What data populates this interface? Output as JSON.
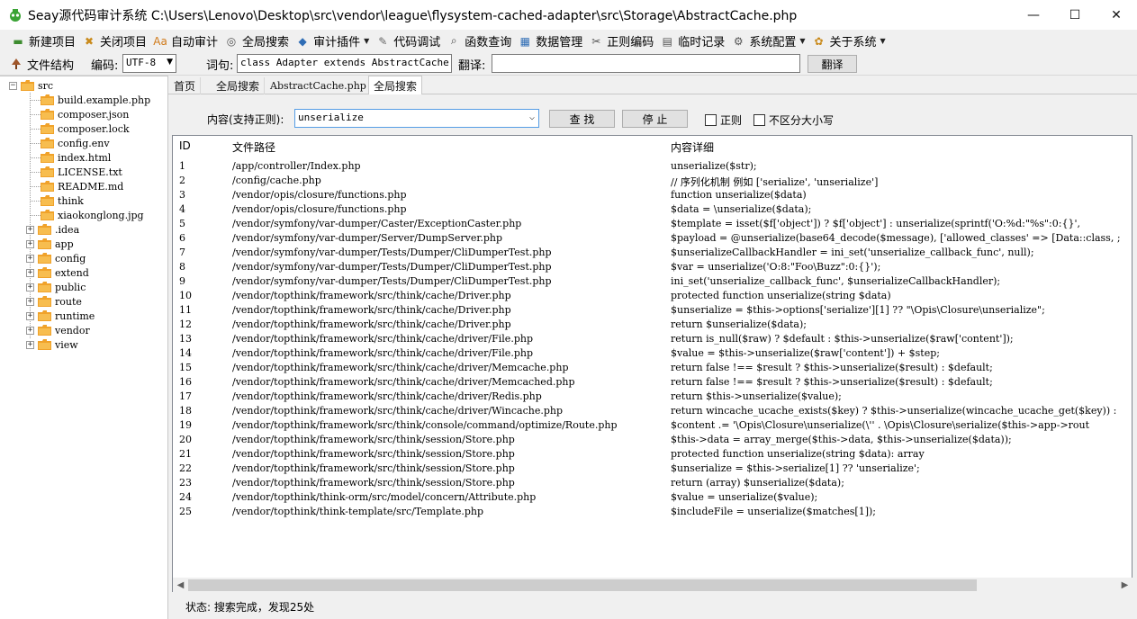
{
  "window": {
    "title": "Seay源代码审计系统  C:\\Users\\Lenovo\\Desktop\\src\\vendor\\league\\flysystem-cached-adapter\\src\\Storage\\AbstractCache.php",
    "minimize": "—",
    "maximize": "☐",
    "close": "✕"
  },
  "menu": [
    {
      "label": "新建项目",
      "icon": "new-project-icon",
      "glyph": "▬",
      "color": "#3d8c2f",
      "dropdown": false
    },
    {
      "label": "关闭项目",
      "icon": "close-project-icon",
      "glyph": "✖",
      "color": "#c98a1b",
      "dropdown": false
    },
    {
      "label": "自动审计",
      "icon": "auto-audit-icon",
      "glyph": "Aa",
      "color": "#d07a1a",
      "dropdown": false
    },
    {
      "label": "全局搜索",
      "icon": "global-search-icon",
      "glyph": "◎",
      "color": "#555555",
      "dropdown": false
    },
    {
      "label": "审计插件",
      "icon": "plugin-icon",
      "glyph": "◆",
      "color": "#2f6db5",
      "dropdown": true
    },
    {
      "label": "代码调试",
      "icon": "debug-icon",
      "glyph": "✎",
      "color": "#666666",
      "dropdown": false
    },
    {
      "label": "函数查询",
      "icon": "function-search-icon",
      "glyph": "⌕",
      "color": "#444444",
      "dropdown": false
    },
    {
      "label": "数据管理",
      "icon": "database-icon",
      "glyph": "▦",
      "color": "#2f6db5",
      "dropdown": false
    },
    {
      "label": "正则编码",
      "icon": "regex-icon",
      "glyph": "✂",
      "color": "#555555",
      "dropdown": false
    },
    {
      "label": "临时记录",
      "icon": "notes-icon",
      "glyph": "▤",
      "color": "#555555",
      "dropdown": false
    },
    {
      "label": "系统配置",
      "icon": "gear-icon",
      "glyph": "⚙",
      "color": "#555555",
      "dropdown": true
    },
    {
      "label": "关于系统",
      "icon": "about-icon",
      "glyph": "✿",
      "color": "#c98a1b",
      "dropdown": true
    }
  ],
  "toolbar": {
    "file_structure": "文件结构",
    "encoding_label": "编码:",
    "encoding_value": "UTF-8",
    "lexicon_label": "词句:",
    "lexicon_value": "class Adapter extends AbstractCache",
    "translate_label": "翻译:",
    "translate_value": "",
    "translate_button": "翻译"
  },
  "tree": {
    "root": "src",
    "files": [
      "build.example.php",
      "composer.json",
      "composer.lock",
      "config.env",
      "index.html",
      "LICENSE.txt",
      "README.md",
      "think",
      "xiaokonglong.jpg"
    ],
    "folders": [
      ".idea",
      "app",
      "config",
      "extend",
      "public",
      "route",
      "runtime",
      "vendor",
      "view"
    ]
  },
  "tabs": [
    "首页",
    "全局搜索",
    "AbstractCache.php",
    "全局搜索"
  ],
  "search": {
    "content_label": "内容(支持正则):",
    "query": "unserialize",
    "find_button": "查 找",
    "stop_button": "停 止",
    "regex_label": "正则",
    "ignore_case_label": "不区分大小写"
  },
  "columns": [
    "ID",
    "文件路径",
    "内容详细"
  ],
  "rows": [
    [
      "1",
      "/app/controller/Index.php",
      "unserialize($str);"
    ],
    [
      "2",
      "/config/cache.php",
      "// 序列化机制 例如 ['serialize', 'unserialize']"
    ],
    [
      "3",
      "/vendor/opis/closure/functions.php",
      "function unserialize($data)"
    ],
    [
      "4",
      "/vendor/opis/closure/functions.php",
      "$data = \\unserialize($data);"
    ],
    [
      "5",
      "/vendor/symfony/var-dumper/Caster/ExceptionCaster.php",
      "$template = isset($f['object']) ? $f['object'] : unserialize(sprintf('O:%d:\"%s\":0:{}',"
    ],
    [
      "6",
      "/vendor/symfony/var-dumper/Server/DumpServer.php",
      "$payload = @unserialize(base64_decode($message), ['allowed_classes' => [Data::class, ;"
    ],
    [
      "7",
      "/vendor/symfony/var-dumper/Tests/Dumper/CliDumperTest.php",
      "$unserializeCallbackHandler = ini_set('unserialize_callback_func', null);"
    ],
    [
      "8",
      "/vendor/symfony/var-dumper/Tests/Dumper/CliDumperTest.php",
      "$var = unserialize('O:8:\"Foo\\Buzz\":0:{}');"
    ],
    [
      "9",
      "/vendor/symfony/var-dumper/Tests/Dumper/CliDumperTest.php",
      "ini_set('unserialize_callback_func', $unserializeCallbackHandler);"
    ],
    [
      "10",
      "/vendor/topthink/framework/src/think/cache/Driver.php",
      "protected function unserialize(string $data)"
    ],
    [
      "11",
      "/vendor/topthink/framework/src/think/cache/Driver.php",
      "$unserialize = $this->options['serialize'][1] ?? \"\\Opis\\Closure\\unserialize\";"
    ],
    [
      "12",
      "/vendor/topthink/framework/src/think/cache/Driver.php",
      "return $unserialize($data);"
    ],
    [
      "13",
      "/vendor/topthink/framework/src/think/cache/driver/File.php",
      "return is_null($raw) ? $default : $this->unserialize($raw['content']);"
    ],
    [
      "14",
      "/vendor/topthink/framework/src/think/cache/driver/File.php",
      "$value  = $this->unserialize($raw['content']) + $step;"
    ],
    [
      "15",
      "/vendor/topthink/framework/src/think/cache/driver/Memcache.php",
      "return false !== $result ? $this->unserialize($result) : $default;"
    ],
    [
      "16",
      "/vendor/topthink/framework/src/think/cache/driver/Memcached.php",
      "return false !== $result ? $this->unserialize($result) : $default;"
    ],
    [
      "17",
      "/vendor/topthink/framework/src/think/cache/driver/Redis.php",
      "return $this->unserialize($value);"
    ],
    [
      "18",
      "/vendor/topthink/framework/src/think/cache/driver/Wincache.php",
      "return wincache_ucache_exists($key) ? $this->unserialize(wincache_ucache_get($key)) :"
    ],
    [
      "19",
      "/vendor/topthink/framework/src/think/console/command/optimize/Route.php",
      "$content .= '\\Opis\\Closure\\unserialize(\\'' . \\Opis\\Closure\\serialize($this->app->rout"
    ],
    [
      "20",
      "/vendor/topthink/framework/src/think/session/Store.php",
      "$this->data = array_merge($this->data, $this->unserialize($data));"
    ],
    [
      "21",
      "/vendor/topthink/framework/src/think/session/Store.php",
      "protected function unserialize(string $data): array"
    ],
    [
      "22",
      "/vendor/topthink/framework/src/think/session/Store.php",
      "$unserialize = $this->serialize[1] ?? 'unserialize';"
    ],
    [
      "23",
      "/vendor/topthink/framework/src/think/session/Store.php",
      "return (array) $unserialize($data);"
    ],
    [
      "24",
      "/vendor/topthink/think-orm/src/model/concern/Attribute.php",
      "$value = unserialize($value);"
    ],
    [
      "25",
      "/vendor/topthink/think-template/src/Template.php",
      "$includeFile = unserialize($matches[1]);"
    ]
  ],
  "status": "状态: 搜索完成，发现25处",
  "colors": {
    "folder": "#f0a22a",
    "app_icon": "#3aa335",
    "combo_border": "#569de5"
  }
}
